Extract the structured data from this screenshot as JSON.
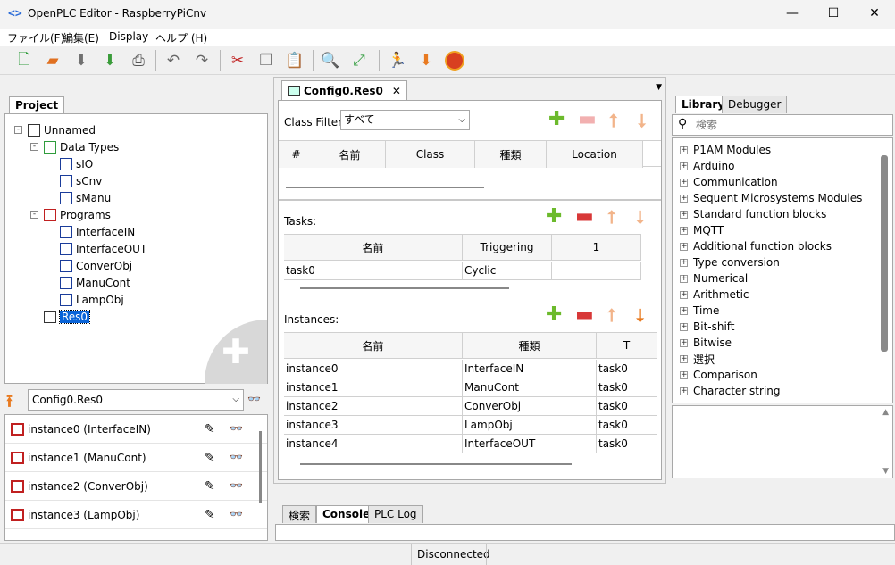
{
  "window": {
    "title": "OpenPLC Editor - RaspberryPiCnv",
    "icon": "code-icon"
  },
  "menu": [
    "ファイル(F)",
    "編集(E)",
    "Display",
    "ヘルプ (H)"
  ],
  "toolbar": [
    "new-file-icon",
    "open-folder-icon",
    "save-icon",
    "save-as-icon",
    "print-icon",
    "undo-icon",
    "redo-icon",
    "cut-icon",
    "copy-icon",
    "paste-icon",
    "find-icon",
    "fullscreen-icon",
    "run-icon",
    "download-icon",
    "plc-icon"
  ],
  "project": {
    "tab": "Project",
    "tree": [
      {
        "label": "Unnamed",
        "level": 0,
        "icon": "config-icon",
        "exp": "-"
      },
      {
        "label": "Data Types",
        "level": 1,
        "icon": "datatypes-icon",
        "exp": "-"
      },
      {
        "label": "sIO",
        "level": 2,
        "icon": "datatype-icon"
      },
      {
        "label": "sCnv",
        "level": 2,
        "icon": "datatype-icon"
      },
      {
        "label": "sManu",
        "level": 2,
        "icon": "datatype-icon"
      },
      {
        "label": "Programs",
        "level": 1,
        "icon": "programs-icon",
        "exp": "-"
      },
      {
        "label": "InterfaceIN",
        "level": 2,
        "icon": "program-icon"
      },
      {
        "label": "InterfaceOUT",
        "level": 2,
        "icon": "program-icon"
      },
      {
        "label": "ConverObj",
        "level": 2,
        "icon": "program-icon"
      },
      {
        "label": "ManuCont",
        "level": 2,
        "icon": "program-icon"
      },
      {
        "label": "LampObj",
        "level": 2,
        "icon": "program-icon"
      },
      {
        "label": "Res0",
        "level": 1,
        "icon": "resource-icon",
        "selected": true
      }
    ]
  },
  "instances_panel": {
    "selector": "Config0.Res0",
    "items": [
      "instance0 (InterfaceIN)",
      "instance1 (ManuCont)",
      "instance2 (ConverObj)",
      "instance3 (LampObj)"
    ]
  },
  "editor": {
    "tab": "Config0.Res0",
    "class_filter_label": "Class Filter:",
    "class_filter_value": "すべて",
    "var_headers": [
      "#",
      "名前",
      "Class",
      "種類",
      "Location"
    ],
    "tasks_label": "Tasks:",
    "task_headers": [
      "名前",
      "Triggering",
      "1"
    ],
    "tasks": [
      [
        "task0",
        "Cyclic",
        ""
      ]
    ],
    "instances_label": "Instances:",
    "inst_headers": [
      "名前",
      "種類",
      "T"
    ],
    "instances": [
      [
        "instance0",
        "InterfaceIN",
        "task0"
      ],
      [
        "instance1",
        "ManuCont",
        "task0"
      ],
      [
        "instance2",
        "ConverObj",
        "task0"
      ],
      [
        "instance3",
        "LampObj",
        "task0"
      ],
      [
        "instance4",
        "InterfaceOUT",
        "task0"
      ]
    ]
  },
  "library": {
    "tabs": [
      "Library",
      "Debugger"
    ],
    "search_placeholder": "検索",
    "items": [
      "P1AM Modules",
      "Arduino",
      "Communication",
      "Sequent Microsystems Modules",
      "Standard function blocks",
      "MQTT",
      "Additional function blocks",
      "Type conversion",
      "Numerical",
      "Arithmetic",
      "Time",
      "Bit-shift",
      "Bitwise",
      "選択",
      "Comparison",
      "Character string"
    ]
  },
  "bottom": {
    "tabs": [
      "検索",
      "Console",
      "PLC Log"
    ],
    "active": "Console"
  },
  "status": "Disconnected",
  "colors": {
    "selection": "#0a64d8",
    "add": "#6cba2c",
    "remove": "#d83838",
    "arrow_disabled": "#f2b48a",
    "arrow_enabled": "#e87a20"
  }
}
